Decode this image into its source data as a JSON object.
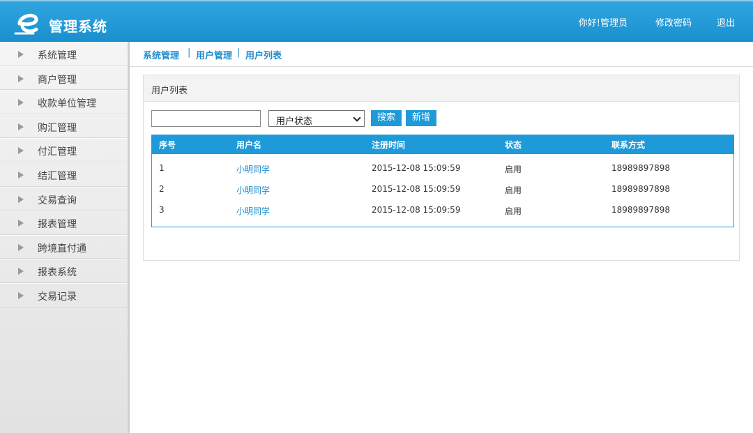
{
  "header": {
    "app_title": "管理系统",
    "logo_icon": "e-logo-icon",
    "links": [
      "你好!管理员",
      "修改密码",
      "退出"
    ]
  },
  "sidebar": {
    "items": [
      {
        "label": "系统管理"
      },
      {
        "label": "商户管理"
      },
      {
        "label": "收款单位管理"
      },
      {
        "label": "购汇管理"
      },
      {
        "label": "付汇管理"
      },
      {
        "label": "结汇管理"
      },
      {
        "label": "交易查询"
      },
      {
        "label": "报表管理"
      },
      {
        "label": "跨境直付通"
      },
      {
        "label": "报表系统"
      },
      {
        "label": "交易记录"
      }
    ],
    "arrow_icon": "triangle-right-icon"
  },
  "breadcrumb": {
    "items": [
      "系统管理",
      "用户管理",
      "用户列表"
    ],
    "separator": "|"
  },
  "panel": {
    "title": "用户列表",
    "search": {
      "value": "",
      "placeholder": ""
    },
    "status_select": {
      "selected": "用户状态"
    },
    "search_button": "搜索",
    "add_button": "新增"
  },
  "table": {
    "columns": [
      "序号",
      "用户名",
      "注册时间",
      "状态",
      "联系方式"
    ],
    "rows": [
      [
        "1",
        "小明同学",
        "2015-12-08 15:09:59",
        "启用",
        "18989897898"
      ],
      [
        "2",
        "小明同学",
        "2015-12-08 15:09:59",
        "启用",
        "18989897898"
      ],
      [
        "3",
        "小明同学",
        "2015-12-08 15:09:59",
        "启用",
        "18989897898"
      ]
    ]
  },
  "colors": {
    "accent": "#1f9ad9",
    "link": "#1d8ccf"
  }
}
